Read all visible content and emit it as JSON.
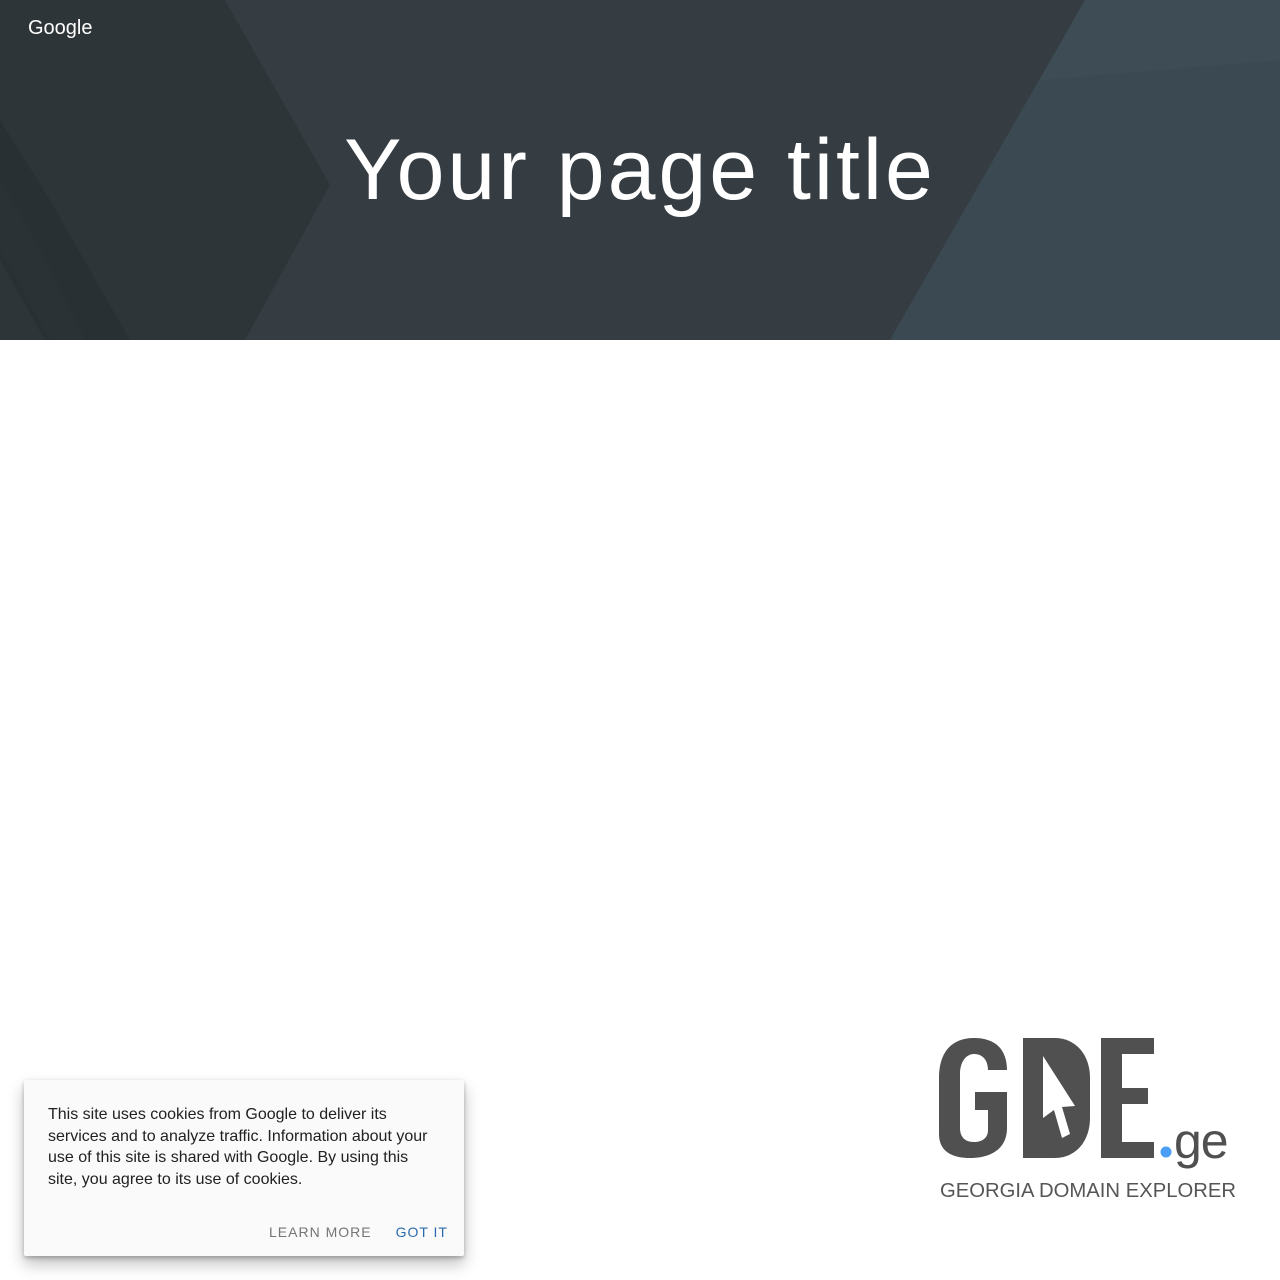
{
  "header": {
    "site_name": "Google",
    "page_title": "Your page title"
  },
  "logo": {
    "main_text": "GDE",
    "suffix_text": ".ge",
    "tagline": "GEORGIA DOMAIN EXPLORER",
    "accent_color": "#4a9ff5",
    "text_color": "#505050"
  },
  "cookie_notice": {
    "message": "This site uses cookies from Google to deliver its services and to analyze traffic. Information about your use of this site is shared with Google. By using this site, you agree to its use of cookies.",
    "learn_more_label": "Learn more",
    "got_it_label": "Got it"
  },
  "colors": {
    "header_bg": "#343c42",
    "accent_button": "#2b6cb0"
  }
}
